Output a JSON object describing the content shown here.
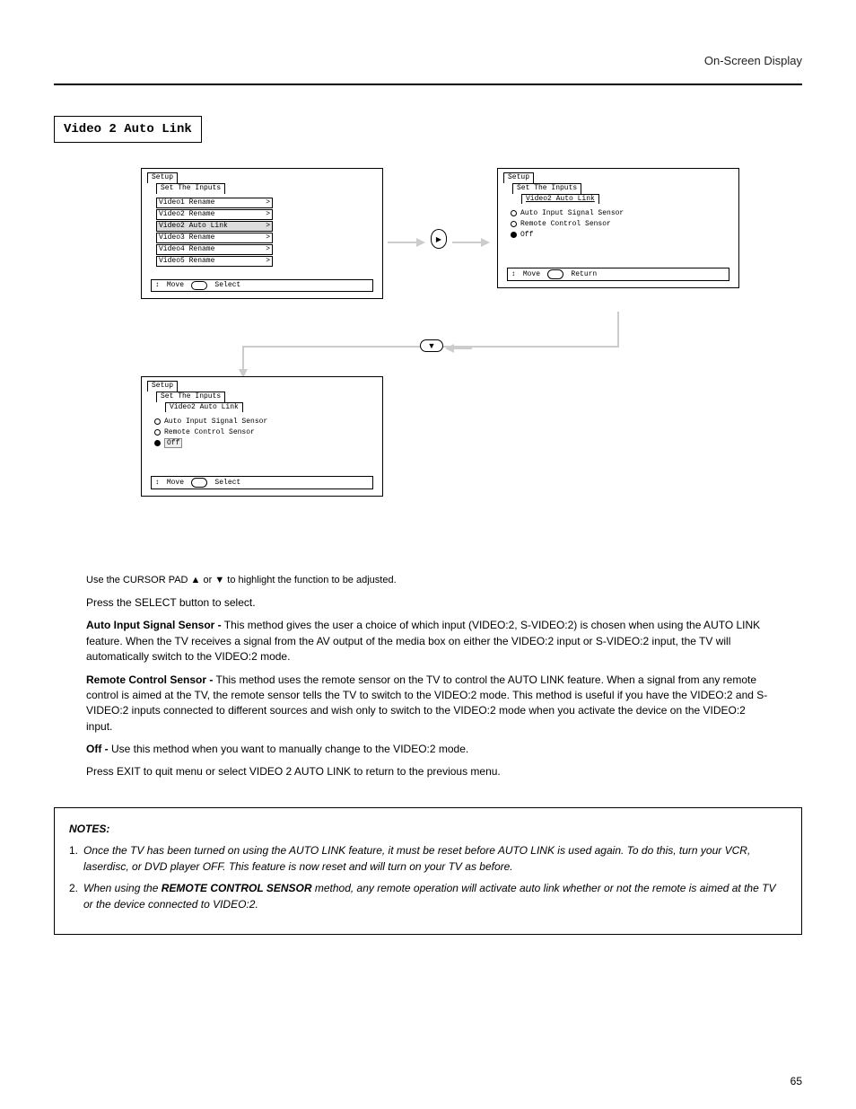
{
  "header": {
    "breadcrumb": "On-Screen Display"
  },
  "title": "Video 2 Auto Link",
  "osd_common": {
    "tab_setup": "Setup",
    "tab_inputs": "Set The Inputs",
    "tab_autolink": "Video2 Auto Link",
    "chevron": ">",
    "hint_move": "Move",
    "hint_select": "Select",
    "hint_return": "Return",
    "hint_arrows": "↕"
  },
  "buttons": {
    "right": "▶",
    "down": "▼"
  },
  "osd1": {
    "items": [
      {
        "label": "Video1 Rename",
        "selected": false
      },
      {
        "label": "Video2 Rename",
        "selected": false
      },
      {
        "label": "Video2 Auto Link",
        "selected": true
      },
      {
        "label": "Video3 Rename",
        "selected": false
      },
      {
        "label": "Video4 Rename",
        "selected": false
      },
      {
        "label": "Video5 Rename",
        "selected": false
      }
    ]
  },
  "osd2": {
    "options": [
      {
        "label": "Auto Input Signal Sensor",
        "checked": false,
        "selected": false
      },
      {
        "label": "Remote Control Sensor",
        "checked": false,
        "selected": false
      },
      {
        "label": "Off",
        "checked": true,
        "selected": false
      }
    ]
  },
  "osd3": {
    "options": [
      {
        "label": "Auto Input Signal Sensor",
        "checked": false,
        "selected": false
      },
      {
        "label": "Remote Control Sensor",
        "checked": false,
        "selected": false
      },
      {
        "label": "Off",
        "checked": true,
        "selected": true
      }
    ]
  },
  "steps": {
    "s1": "Use the CURSOR PAD ▲ or ▼ to highlight the function to be adjusted.",
    "s2": "Press the SELECT button to select.",
    "auto_head": "Auto Input Signal Sensor -",
    "auto_body": "This method gives the user a choice of which input (VIDEO:2, S-VIDEO:2) is chosen when using the AUTO LINK feature. When the TV receives a signal from the AV output of the media box on either the VIDEO:2 input or S-VIDEO:2 input, the TV will automatically switch to the VIDEO:2 mode.",
    "remote_head": "Remote Control Sensor -",
    "remote_body": "This method uses the remote sensor on the TV to control the AUTO LINK feature. When a signal from any remote control is aimed at the TV, the remote sensor tells the TV to switch to the VIDEO:2 mode. This method is useful if you have the VIDEO:2 and S-VIDEO:2 inputs connected to different sources and wish only to switch to the VIDEO:2 mode when you activate the device on the VIDEO:2 input.",
    "off_head": "Off -",
    "off_body": "Use this method when you want to manually change to the VIDEO:2 mode.",
    "s3": "Press EXIT to quit menu or select VIDEO 2 AUTO LINK to return to the previous menu."
  },
  "notes": {
    "head": "NOTES:",
    "n1": "Once the TV has been turned on using the AUTO LINK feature, it must be reset before AUTO LINK is used again. To do this, turn your VCR, laserdisc, or DVD player OFF. This feature is now reset and will turn on your TV as before.",
    "n2_pre": "When using the ",
    "n2_term": "REMOTE CONTROL SENSOR",
    "n2_post": " method, any remote operation will activate auto link whether or not the remote is aimed at the TV or the device connected to VIDEO:2."
  },
  "page_number": "65"
}
